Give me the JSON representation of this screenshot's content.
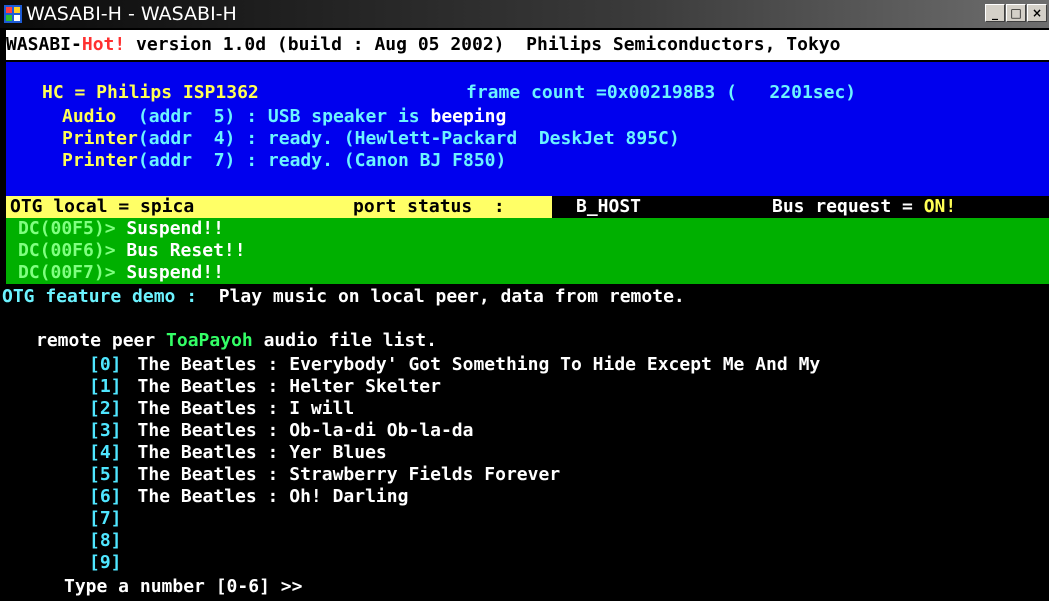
{
  "window": {
    "title": "WASABI-H - WASABI-H",
    "buttons": [
      "_",
      "□",
      "×"
    ]
  },
  "header": {
    "app_prefix": "WASABI-",
    "app_hot": "Hot!",
    "rest": " version 1.0d (build : Aug 05 2002)  Philips Semiconductors, Tokyo"
  },
  "status": {
    "hc_label": "HC = Philips ISP1362",
    "frame_count": "frame count =0x002198B3 (   2201sec)",
    "devices": [
      {
        "kind": "Audio",
        "addr": "  (addr  5)",
        "desc": " : USB speaker is ",
        "state": "beeping"
      },
      {
        "kind": "Printer",
        "addr": "(addr  4)",
        "desc": " : ready. (Hewlett-Packard  DeskJet 895C)",
        "state": ""
      },
      {
        "kind": "Printer",
        "addr": "(addr  7)",
        "desc": " : ready. (Canon BJ F850)",
        "state": ""
      }
    ]
  },
  "otg": {
    "local": "OTG local = spica",
    "port_status": "port status  :",
    "mode": "B_HOST",
    "bus_request_label": "Bus request = ",
    "bus_request_value": "ON!"
  },
  "log": [
    {
      "prefix": "DC(00F5)> ",
      "msg": "Suspend!!"
    },
    {
      "prefix": "DC(00F6)> ",
      "msg": "Bus Reset!!"
    },
    {
      "prefix": "DC(00F7)> ",
      "msg": "Suspend!!"
    }
  ],
  "demo": {
    "feature_label": "OTG feature demo :",
    "feature_desc": "  Play music on local peer, data from remote.",
    "list_prefix": "remote peer ",
    "peer_name": "ToaPayoh",
    "list_suffix": " audio file list.",
    "tracks": [
      {
        "index": "[0]",
        "title": "The Beatles : Everybody' Got Something To Hide Except Me And My"
      },
      {
        "index": "[1]",
        "title": "The Beatles : Helter Skelter"
      },
      {
        "index": "[2]",
        "title": "The Beatles : I will"
      },
      {
        "index": "[3]",
        "title": "The Beatles : Ob-la-di Ob-la-da"
      },
      {
        "index": "[4]",
        "title": "The Beatles : Yer Blues"
      },
      {
        "index": "[5]",
        "title": "The Beatles : Strawberry Fields Forever"
      },
      {
        "index": "[6]",
        "title": "The Beatles : Oh! Darling"
      },
      {
        "index": "[7]",
        "title": ""
      },
      {
        "index": "[8]",
        "title": ""
      },
      {
        "index": "[9]",
        "title": ""
      }
    ],
    "prompt": "Type a number [0-6] >>"
  },
  "colors": {
    "header_bg": "#ffffff",
    "status_bg": "#0000ee",
    "otg_highlight": "#ffff66",
    "log_bg": "#00b000",
    "main_bg": "#000000",
    "hot_red": "#ff3030",
    "cyan": "#6cf3ff",
    "peer_green": "#33ff66"
  }
}
